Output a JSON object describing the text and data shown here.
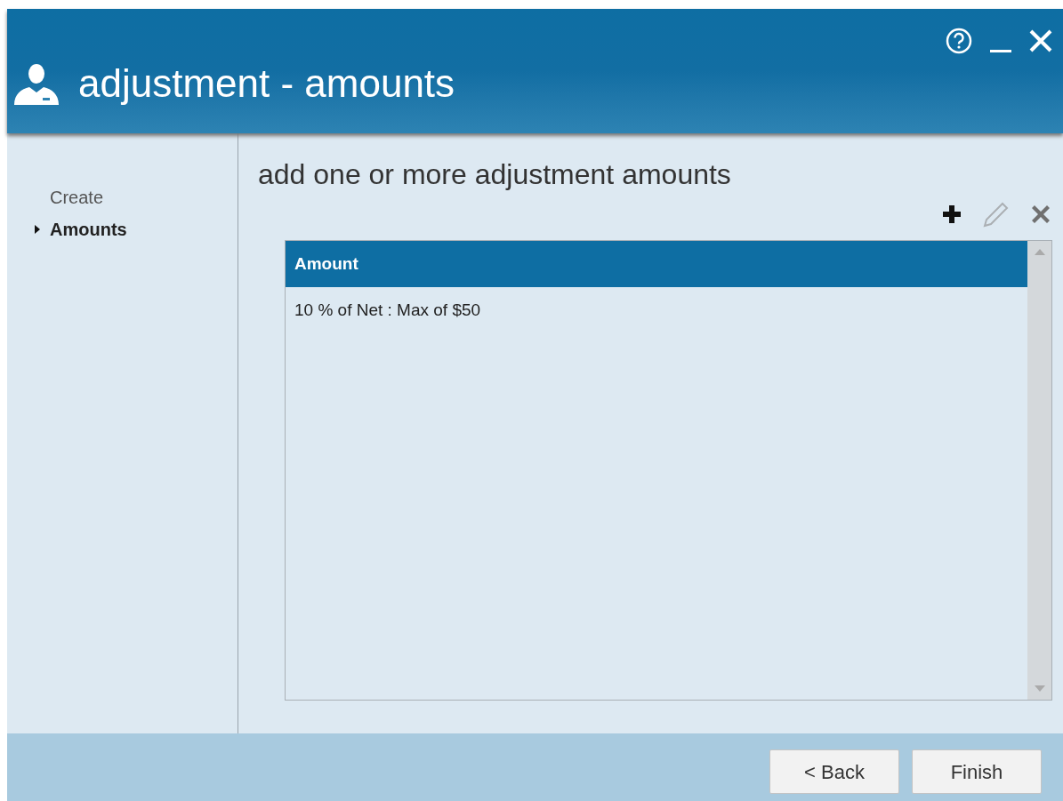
{
  "window": {
    "title": "adjustment - amounts"
  },
  "sidebar": {
    "items": [
      {
        "label": "Create",
        "selected": false
      },
      {
        "label": "Amounts",
        "selected": true
      }
    ]
  },
  "content": {
    "heading": "add one or more adjustment amounts",
    "toolbar": [
      {
        "kind": "add",
        "disabled": false
      },
      {
        "kind": "edit",
        "disabled": true
      },
      {
        "kind": "delete",
        "disabled": true
      }
    ],
    "table": {
      "columns": [
        "Amount"
      ],
      "rows": [
        [
          "10 % of Net : Max of $50"
        ]
      ]
    }
  },
  "buttons": [
    {
      "label": "< Back"
    },
    {
      "label": "Finish"
    }
  ]
}
